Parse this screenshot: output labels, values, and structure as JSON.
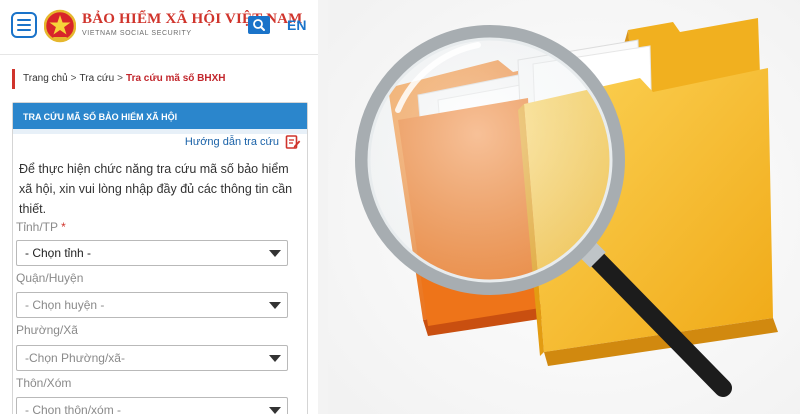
{
  "header": {
    "brand_title": "BẢO HIỂM XÃ HỘI VIỆT NAM",
    "brand_subtitle": "VIETNAM SOCIAL SECURITY",
    "language": "EN"
  },
  "breadcrumb": {
    "items": [
      "Trang chủ",
      "Tra cứu"
    ],
    "current": "Tra cứu mã số BHXH",
    "separator": ">"
  },
  "panel": {
    "title": "TRA CỨU MÃ SỐ BẢO HIỂM XÃ HỘI",
    "guide_link": "Hướng dẫn tra cứu",
    "intro": "Để thực hiện chức năng tra cứu mã số bảo hiểm xã hội, xin vui lòng nhập đầy đủ các thông tin cần thiết."
  },
  "form": {
    "fields": [
      {
        "label": "Tỉnh/TP",
        "required": "*",
        "selected": "- Chọn tỉnh -"
      },
      {
        "label": "Quận/Huyện",
        "selected": "- Chọn huyện -"
      },
      {
        "label": "Phường/Xã",
        "selected": "-Chọn Phường/xã-"
      },
      {
        "label": "Thôn/Xóm",
        "selected": "- Chọn thôn/xóm -"
      }
    ]
  },
  "colors": {
    "brand_red": "#d0342c",
    "accent_blue": "#1a73c9",
    "panel_header": "#2b86cc",
    "folder_yellow": "#f5b81c",
    "folder_orange": "#f07a1a"
  }
}
